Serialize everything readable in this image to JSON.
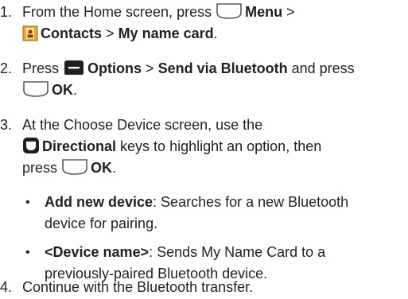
{
  "steps": [
    {
      "num": "1.",
      "a": "From the Home screen, press",
      "b": "Menu",
      "c": ">",
      "d": "Contacts",
      "e": ">",
      "f": "My name card",
      "g": "."
    },
    {
      "num": "2.",
      "a": "Press",
      "b": "Options",
      "c": ">",
      "d": "Send via Bluetooth",
      "e": "and press",
      "f": "OK",
      "g": "."
    },
    {
      "num": "3.",
      "a": "At the Choose Device screen, use the",
      "b": "Directional",
      "c": "keys to highlight an option, then",
      "d": "press",
      "e": "OK",
      "f": "."
    },
    {
      "num": "4.",
      "a": "Continue with the Bluetooth transfer."
    }
  ],
  "bullets": [
    {
      "dot": "•",
      "bold": "Add new device",
      "text1": ": Searches for a new Bluetooth",
      "text2": "device for pairing."
    },
    {
      "dot": "•",
      "bold": "<Device name>",
      "text1": ": Sends My Name Card to a",
      "text2": "previously-paired Bluetooth device."
    }
  ],
  "icons": {
    "center_key": "center-select-key-icon",
    "contacts": "contacts-app-icon",
    "options_key": "left-soft-key-icon",
    "directional_key": "directional-pad-icon"
  },
  "colors": {
    "text": "#231f20",
    "key_fill": "#ffffff",
    "key_stroke": "#5a5a5a",
    "soft_key": "#231f20",
    "contacts_orange": "#f4a52b"
  }
}
